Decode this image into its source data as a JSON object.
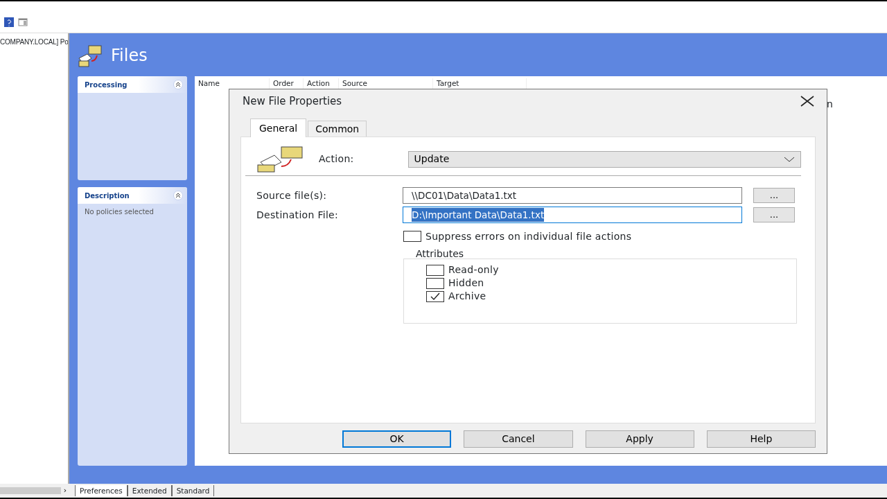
{
  "toolbar": {
    "buttons": [
      {
        "kind": "help"
      },
      {
        "kind": "pane"
      }
    ]
  },
  "tree": {
    "items": [
      "COMPANY.LOCAL] Po"
    ]
  },
  "header": {
    "title": "Files"
  },
  "task_panes": [
    {
      "title": "Processing"
    },
    {
      "title": "Description",
      "text": "No policies selected"
    }
  ],
  "list": {
    "columns": [
      "Name",
      "Order",
      "Action",
      "Source",
      "Target"
    ],
    "fragment": "n"
  },
  "dialog": {
    "title": "New File Properties",
    "tabs": [
      {
        "label": "General",
        "selected": true
      },
      {
        "label": "Common",
        "selected": false
      }
    ],
    "action": {
      "label": "Action:",
      "value": "Update"
    },
    "source": {
      "label": "Source file(s):",
      "value": "\\\\DC01\\Data\\Data1.txt",
      "browse": "..."
    },
    "destination": {
      "label": "Destination File:",
      "value": "D:\\Important Data\\Data1.txt",
      "selected": true,
      "browse": "..."
    },
    "suppress": {
      "label": "Suppress errors on individual file actions",
      "checked": false
    },
    "attributes": {
      "title": "Attributes",
      "items": [
        {
          "label": "Read-only",
          "checked": false
        },
        {
          "label": "Hidden",
          "checked": false
        },
        {
          "label": "Archive",
          "checked": true
        }
      ]
    },
    "buttons": [
      {
        "label": "OK",
        "default": true
      },
      {
        "label": "Cancel",
        "default": false
      },
      {
        "label": "Apply",
        "default": false
      },
      {
        "label": "Help",
        "default": false
      }
    ]
  },
  "scroll_arrow": "›",
  "bottom_tabs": [
    {
      "label": "Preferences",
      "selected": true
    },
    {
      "label": "Extended",
      "selected": false
    },
    {
      "label": "Standard",
      "selected": false
    }
  ]
}
